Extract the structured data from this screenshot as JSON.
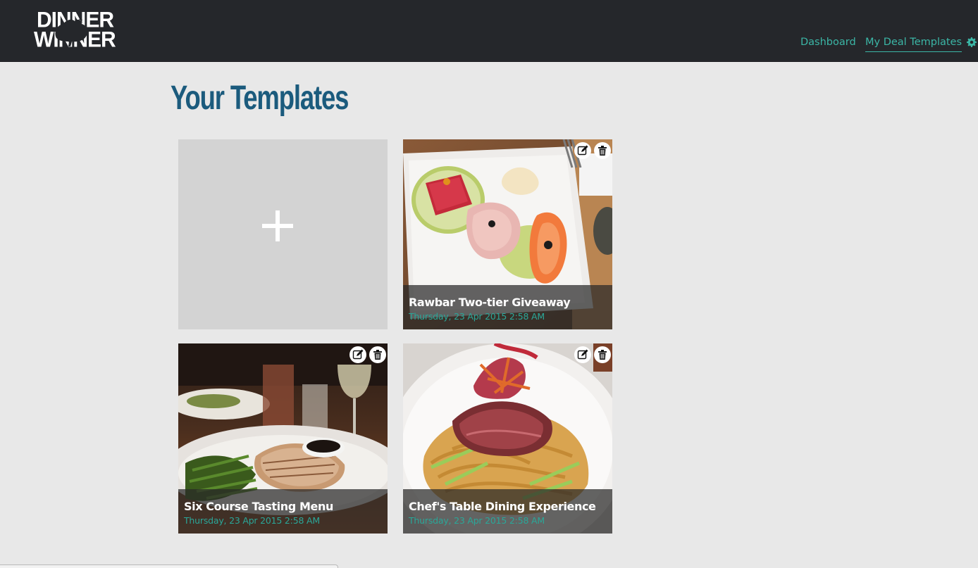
{
  "brand": {
    "logo_line1": "DINNER",
    "logo_line2": "WINNER",
    "logo_icon": "rooster-silhouette"
  },
  "nav": {
    "items": [
      {
        "label": "Dashboard",
        "active": false
      },
      {
        "label": "My Deal Templates",
        "active": true
      }
    ],
    "settings_icon": "gear-icon"
  },
  "page": {
    "title": "Your Templates"
  },
  "add_card": {
    "icon": "plus-icon"
  },
  "templates": [
    {
      "title": "Rawbar Two-tier Giveaway",
      "date": "Thursday, 23 Apr 2015 2:58 AM",
      "image": "sashimi plate with cucumber slices and ginger",
      "edit_icon": "edit-icon",
      "delete_icon": "trash-icon"
    },
    {
      "title": "Six Course Tasting Menu",
      "date": "Thursday, 23 Apr 2015 2:58 AM",
      "image": "grilled fish with green beans and wine glasses",
      "edit_icon": "edit-icon",
      "delete_icon": "trash-icon"
    },
    {
      "title": "Chef's Table Dining Experience",
      "date": "Thursday, 23 Apr 2015 2:58 AM",
      "image": "sliced beef over noodles with vegetables",
      "edit_icon": "edit-icon",
      "delete_icon": "trash-icon"
    }
  ],
  "colors": {
    "topbar": "#25272b",
    "accent": "#3bb6a6",
    "title": "#1b5b7d",
    "background": "#e8e8e8"
  }
}
